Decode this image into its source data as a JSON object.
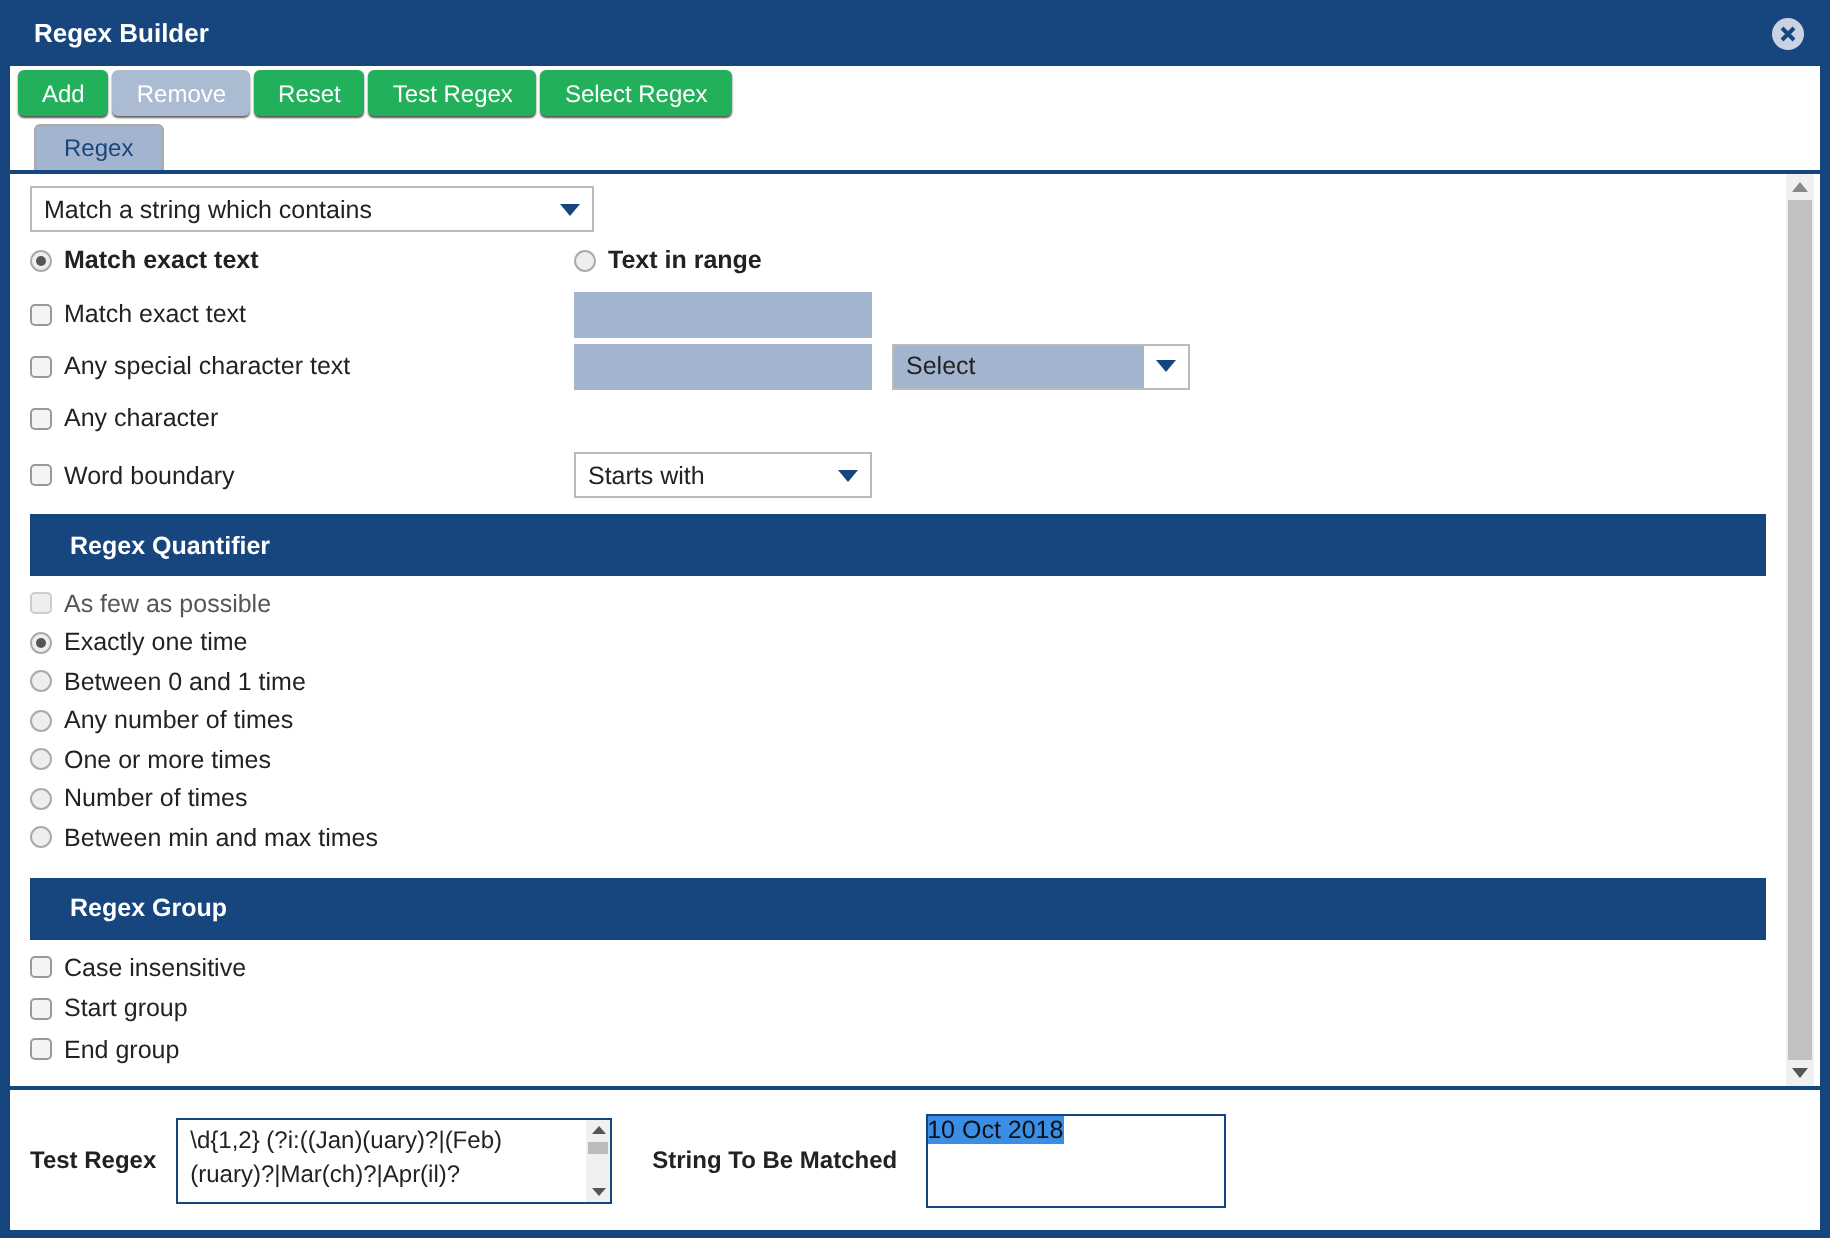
{
  "window": {
    "title": "Regex Builder"
  },
  "toolbar": [
    {
      "label": "Add",
      "disabled": false
    },
    {
      "label": "Remove",
      "disabled": true
    },
    {
      "label": "Reset",
      "disabled": false
    },
    {
      "label": "Test Regex",
      "disabled": false
    },
    {
      "label": "Select Regex",
      "disabled": false
    }
  ],
  "tabs": [
    {
      "label": "Regex",
      "selected": true
    }
  ],
  "match_type": {
    "value": "Match a string which contains"
  },
  "modes": [
    {
      "label": "Match exact text",
      "selected": true
    },
    {
      "label": "Text in range",
      "selected": false
    }
  ],
  "criteria": [
    {
      "label": "Match exact text",
      "checked": false,
      "kind": "text"
    },
    {
      "label": "Any special character text",
      "checked": false,
      "kind": "text_select",
      "select_value": "Select"
    },
    {
      "label": "Any character",
      "checked": false,
      "kind": "plain"
    },
    {
      "label": "Word boundary",
      "checked": false,
      "kind": "select",
      "select_value": "Starts with"
    }
  ],
  "quantifier": {
    "title": "Regex Quantifier",
    "options": [
      {
        "label": "As few as possible",
        "kind": "checkbox",
        "selected": false,
        "disabled": true
      },
      {
        "label": "Exactly one time",
        "kind": "radio",
        "selected": true,
        "disabled": false
      },
      {
        "label": "Between 0 and 1 time",
        "kind": "radio",
        "selected": false,
        "disabled": false
      },
      {
        "label": "Any number of times",
        "kind": "radio",
        "selected": false,
        "disabled": false
      },
      {
        "label": "One or more times",
        "kind": "radio",
        "selected": false,
        "disabled": false
      },
      {
        "label": "Number of times",
        "kind": "radio",
        "selected": false,
        "disabled": false
      },
      {
        "label": "Between min and max times",
        "kind": "radio",
        "selected": false,
        "disabled": false
      }
    ]
  },
  "group": {
    "title": "Regex Group",
    "options": [
      {
        "label": "Case insensitive",
        "checked": false
      },
      {
        "label": "Start group",
        "checked": false
      },
      {
        "label": "End group",
        "checked": false
      }
    ]
  },
  "test_regex": {
    "label": "Test Regex",
    "value": "\\d{1,2} (?i:((Jan)(uary)?|(Feb)(ruary)?|Mar(ch)?|Apr(il)?"
  },
  "string_to_match": {
    "label": "String To Be Matched",
    "value": "10 Oct 2018"
  }
}
